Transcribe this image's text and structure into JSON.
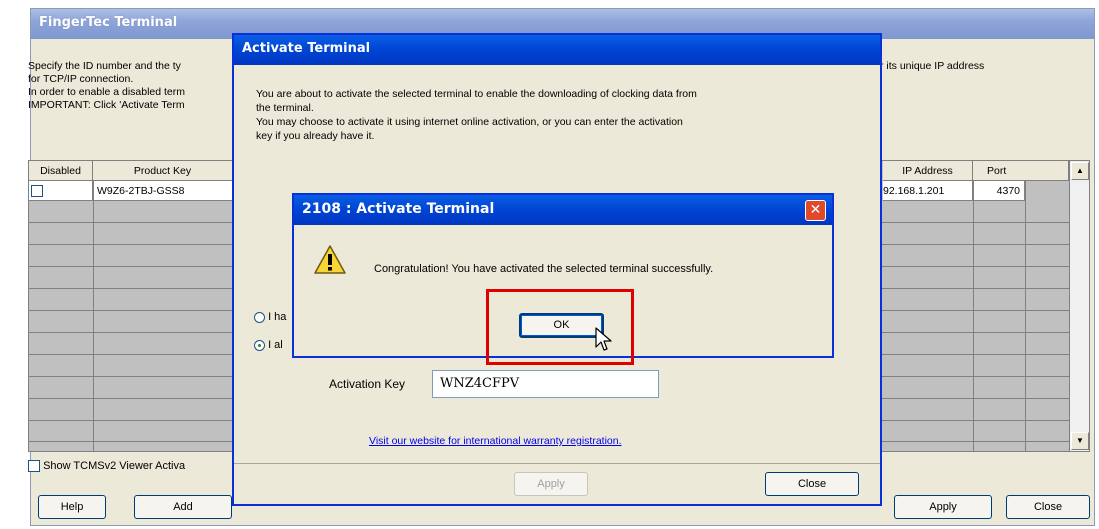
{
  "main_window": {
    "title": "FingerTec Terminal",
    "desc_lines": [
      "Specify the ID number and the ty",
      "for TCP/IP connection.",
      "In order to enable a disabled term",
      "IMPORTANT: Click 'Activate Term"
    ],
    "desc_right": "r its unique IP address",
    "grid": {
      "headers": {
        "disabled": "Disabled",
        "product_key": "Product Key",
        "ip_address": "IP Address",
        "port": "Port"
      },
      "row1": {
        "product_key": "W9Z6-2TBJ-GSS8",
        "ip_address": "92.168.1.201",
        "port": "4370"
      }
    },
    "show_viewer_label": "Show TCMSv2 Viewer Activa",
    "buttons": {
      "help": "Help",
      "add": "Add",
      "apply": "Apply",
      "close": "Close"
    }
  },
  "activate_dialog": {
    "title": "Activate Terminal",
    "text_lines": [
      "You are about to activate the selected terminal to enable the downloading of clocking data from",
      "the terminal.",
      "You may choose to activate it using internet online activation, or you can enter the activation",
      "key if you already have it."
    ],
    "radio1_label": "I ha",
    "radio2_label": "I al",
    "activation_key_label": "Activation Key",
    "activation_key_value": "WNZ4CFPV",
    "website_link": "Visit our website for international warranty registration.",
    "apply_label": "Apply",
    "close_label": "Close"
  },
  "message_box": {
    "title": "2108 : Activate Terminal",
    "message": "Congratulation! You have activated the selected terminal successfully.",
    "ok_label": "OK",
    "close_symbol": "✕"
  },
  "colors": {
    "xp_blue_title": "#0044d4",
    "faded_title": "#8ea5d9",
    "dialog_face": "#ece9d8",
    "highlight_red": "#e00000",
    "link_blue": "#0000ee"
  }
}
